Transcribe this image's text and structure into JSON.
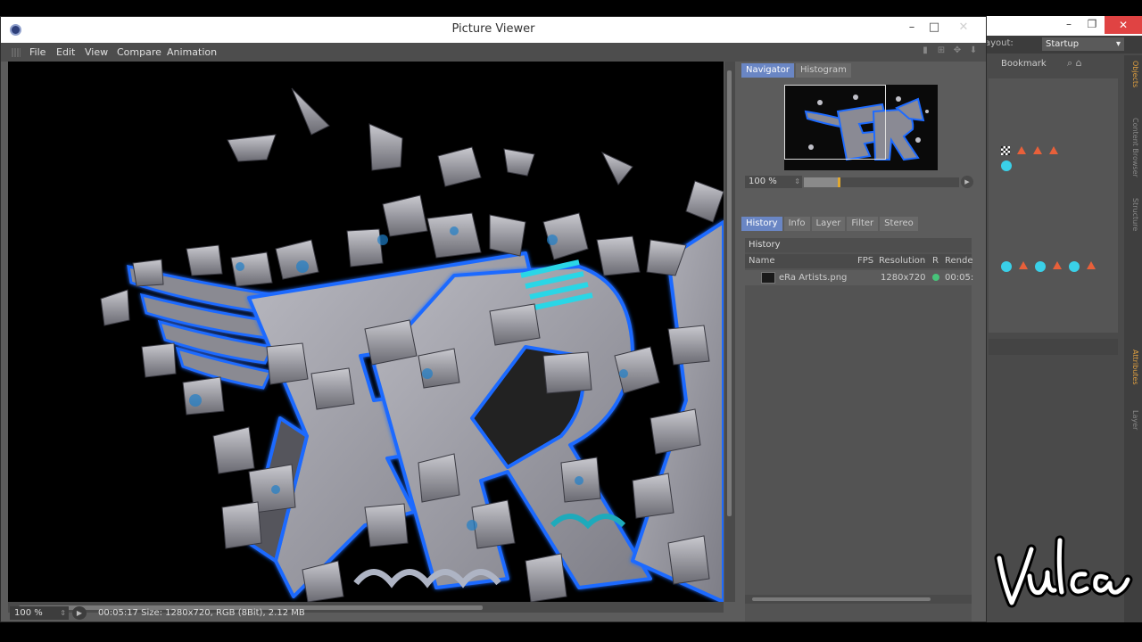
{
  "window": {
    "title": "Picture Viewer",
    "controls": {
      "minimize": "–",
      "maximize": "□",
      "close": "✕"
    }
  },
  "menu": {
    "items": [
      "File",
      "Edit",
      "View",
      "Compare",
      "Animation"
    ]
  },
  "navigator_tabs": [
    "Navigator",
    "Histogram"
  ],
  "navigator": {
    "zoom": "100 %",
    "zoom_level": 0.22
  },
  "detail_tabs": [
    "History",
    "Info",
    "Layer",
    "Filter",
    "Stereo"
  ],
  "history": {
    "section_title": "History",
    "columns": {
      "name": "Name",
      "fps": "FPS",
      "resolution": "Resolution",
      "r": "R",
      "render": "Rende"
    },
    "rows": [
      {
        "name": "eRa Artists.png",
        "resolution": "1280x720",
        "render": "00:05:"
      }
    ]
  },
  "status": {
    "zoom": "100 %",
    "text": "00:05:17   Size: 1280x720, RGB (8Bit), 2.12 MB"
  },
  "background_app": {
    "layout_label": "ayout:",
    "layout_value": "Startup",
    "bookmark": "Bookmark",
    "side_tabs": [
      "Objects",
      "Content Browser",
      "Structure",
      "Attributes",
      "Layer"
    ]
  },
  "watermark": "Vulcan",
  "colors": {
    "accent_tab": "#6a86c4",
    "neon_blue": "#1e6bff",
    "status_green": "#47c47a",
    "warning_orange": "#e8603a"
  }
}
